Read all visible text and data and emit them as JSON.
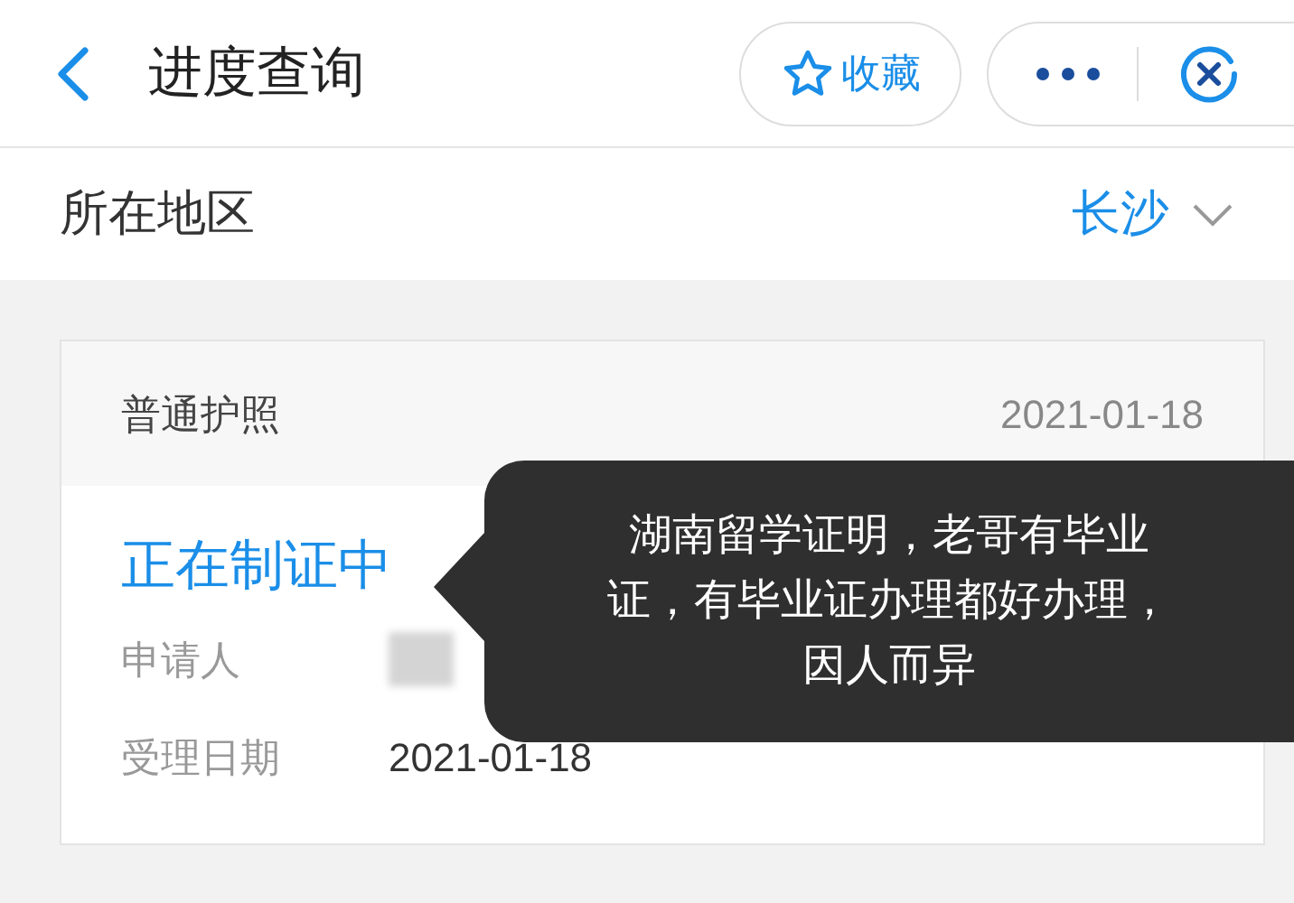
{
  "header": {
    "title": "进度查询",
    "favorite_label": "收藏"
  },
  "region": {
    "label": "所在地区",
    "value": "长沙"
  },
  "card": {
    "type": "普通护照",
    "date": "2021-01-18",
    "status": "正在制证中",
    "fields": [
      {
        "label": "申请人",
        "kind": "blurred"
      },
      {
        "label": "受理日期",
        "kind": "text",
        "value": "2021-01-18"
      }
    ]
  },
  "callout": {
    "text": "湖南留学证明，老哥有毕业证，有毕业证办理都好办理，因人而异"
  }
}
